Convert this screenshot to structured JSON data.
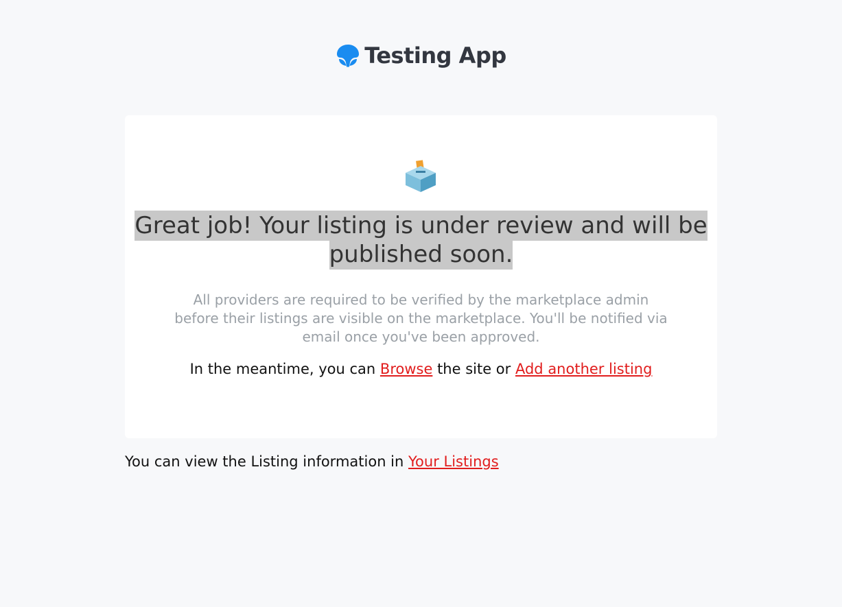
{
  "header": {
    "app_name": "Testing App",
    "logo_icon": "app-logo-icon",
    "brand_color": "#1a8cf0"
  },
  "card": {
    "icon": "ballot-box-icon",
    "headline": "Great job! Your listing is under review and will be published soon.",
    "subtext": "All providers are required to be verified by the marketplace admin before their listings are visible on the marketplace. You'll be notified via email once you've been approved.",
    "meantime_prefix": "In the meantime, you can",
    "browse_link": "Browse",
    "meantime_middle": "the site or",
    "add_listing_link": "Add another listing"
  },
  "footer": {
    "prefix": "You can view the Listing information in",
    "your_listings_link": "Your Listings"
  },
  "colors": {
    "link": "#e11d1d",
    "background": "#f7f8fa",
    "highlight": "#c8c8c8"
  }
}
